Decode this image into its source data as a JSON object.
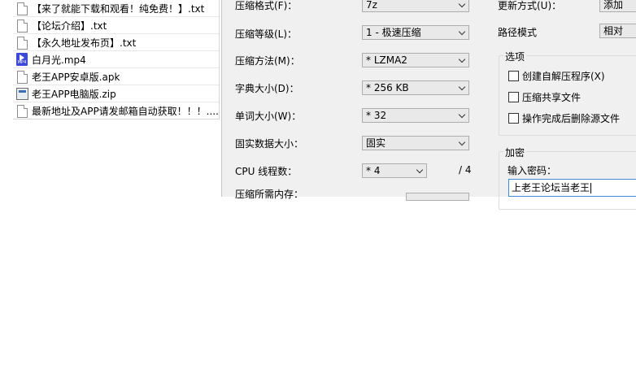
{
  "files": [
    {
      "name": "【来了就能下载和观看！纯免费！】.txt",
      "icon": "text-file-icon"
    },
    {
      "name": "【论坛介绍】.txt",
      "icon": "text-file-icon"
    },
    {
      "name": "【永久地址发布页】.txt",
      "icon": "text-file-icon"
    },
    {
      "name": "白月光.mp4",
      "icon": "video-file-icon",
      "badge": "MP4"
    },
    {
      "name": "老王APP安卓版.apk",
      "icon": "file-icon"
    },
    {
      "name": "老王APP电脑版.zip",
      "icon": "archive-file-icon"
    },
    {
      "name": "最新地址及APP请发邮箱自动获取！！！....",
      "icon": "file-icon"
    }
  ],
  "compression": {
    "format_label": "压缩格式(F)：",
    "format_value": "7z",
    "level_label": "压缩等级(L)：",
    "level_value": "1 - 极速压缩",
    "method_label": "压缩方法(M)：",
    "method_value": "* LZMA2",
    "dict_label": "字典大小(D)：",
    "dict_value": "* 256 KB",
    "word_label": "单词大小(W)：",
    "word_value": "* 32",
    "solid_label": "固实数据大小：",
    "solid_value": "固实",
    "cpu_label": "CPU 线程数：",
    "cpu_value": "* 4",
    "cpu_total": "/ 4",
    "memory_label": "压缩所需内存："
  },
  "right_panel": {
    "update_label": "更新方式(U)：",
    "update_value": "添加",
    "path_label": "路径模式",
    "path_value": "相对",
    "options_title": "选项",
    "options": [
      {
        "label": "创建自解压程序(X)",
        "checked": false
      },
      {
        "label": "压缩共享文件",
        "checked": false
      },
      {
        "label": "操作完成后删除源文件",
        "checked": false
      }
    ],
    "encryption_title": "加密",
    "password_label": "输入密码：",
    "password_value": "上老王论坛当老王"
  }
}
